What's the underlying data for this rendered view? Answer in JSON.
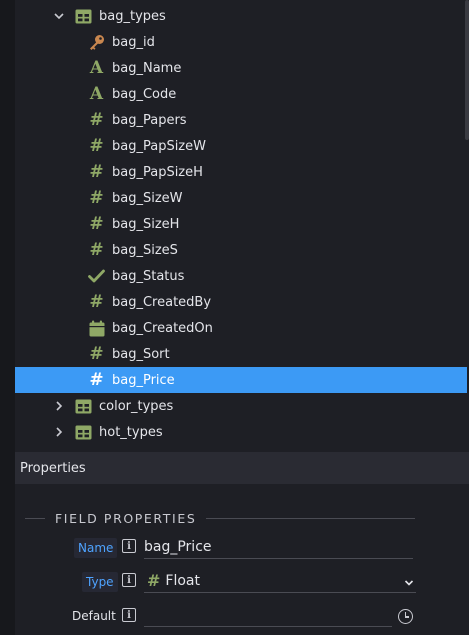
{
  "tree": {
    "expanded_table": {
      "label": "bag_types",
      "icon": "table-icon"
    },
    "fields": [
      {
        "label": "bag_id",
        "icon": "key-icon"
      },
      {
        "label": "bag_Name",
        "icon": "text-type-icon"
      },
      {
        "label": "bag_Code",
        "icon": "text-type-icon"
      },
      {
        "label": "bag_Papers",
        "icon": "number-type-icon"
      },
      {
        "label": "bag_PapSizeW",
        "icon": "number-type-icon"
      },
      {
        "label": "bag_PapSizeH",
        "icon": "number-type-icon"
      },
      {
        "label": "bag_SizeW",
        "icon": "number-type-icon"
      },
      {
        "label": "bag_SizeH",
        "icon": "number-type-icon"
      },
      {
        "label": "bag_SizeS",
        "icon": "number-type-icon"
      },
      {
        "label": "bag_Status",
        "icon": "boolean-type-icon"
      },
      {
        "label": "bag_CreatedBy",
        "icon": "number-type-icon"
      },
      {
        "label": "bag_CreatedOn",
        "icon": "date-type-icon"
      },
      {
        "label": "bag_Sort",
        "icon": "number-type-icon"
      },
      {
        "label": "bag_Price",
        "icon": "number-type-icon",
        "selected": true
      }
    ],
    "collapsed_tables": [
      {
        "label": "color_types",
        "icon": "table-icon"
      },
      {
        "label": "hot_types",
        "icon": "table-icon"
      }
    ]
  },
  "properties": {
    "header": "Properties",
    "section_title": "FIELD PROPERTIES",
    "name_label": "Name",
    "name_value": "bag_Price",
    "type_label": "Type",
    "type_value": "Float",
    "default_label": "Default",
    "default_value": ""
  },
  "colors": {
    "background": "#1e1f25",
    "selection": "#3c9af5",
    "icon_green": "#8fa866",
    "key_orange": "#c9874f",
    "label_blue": "#4ea3ff"
  }
}
